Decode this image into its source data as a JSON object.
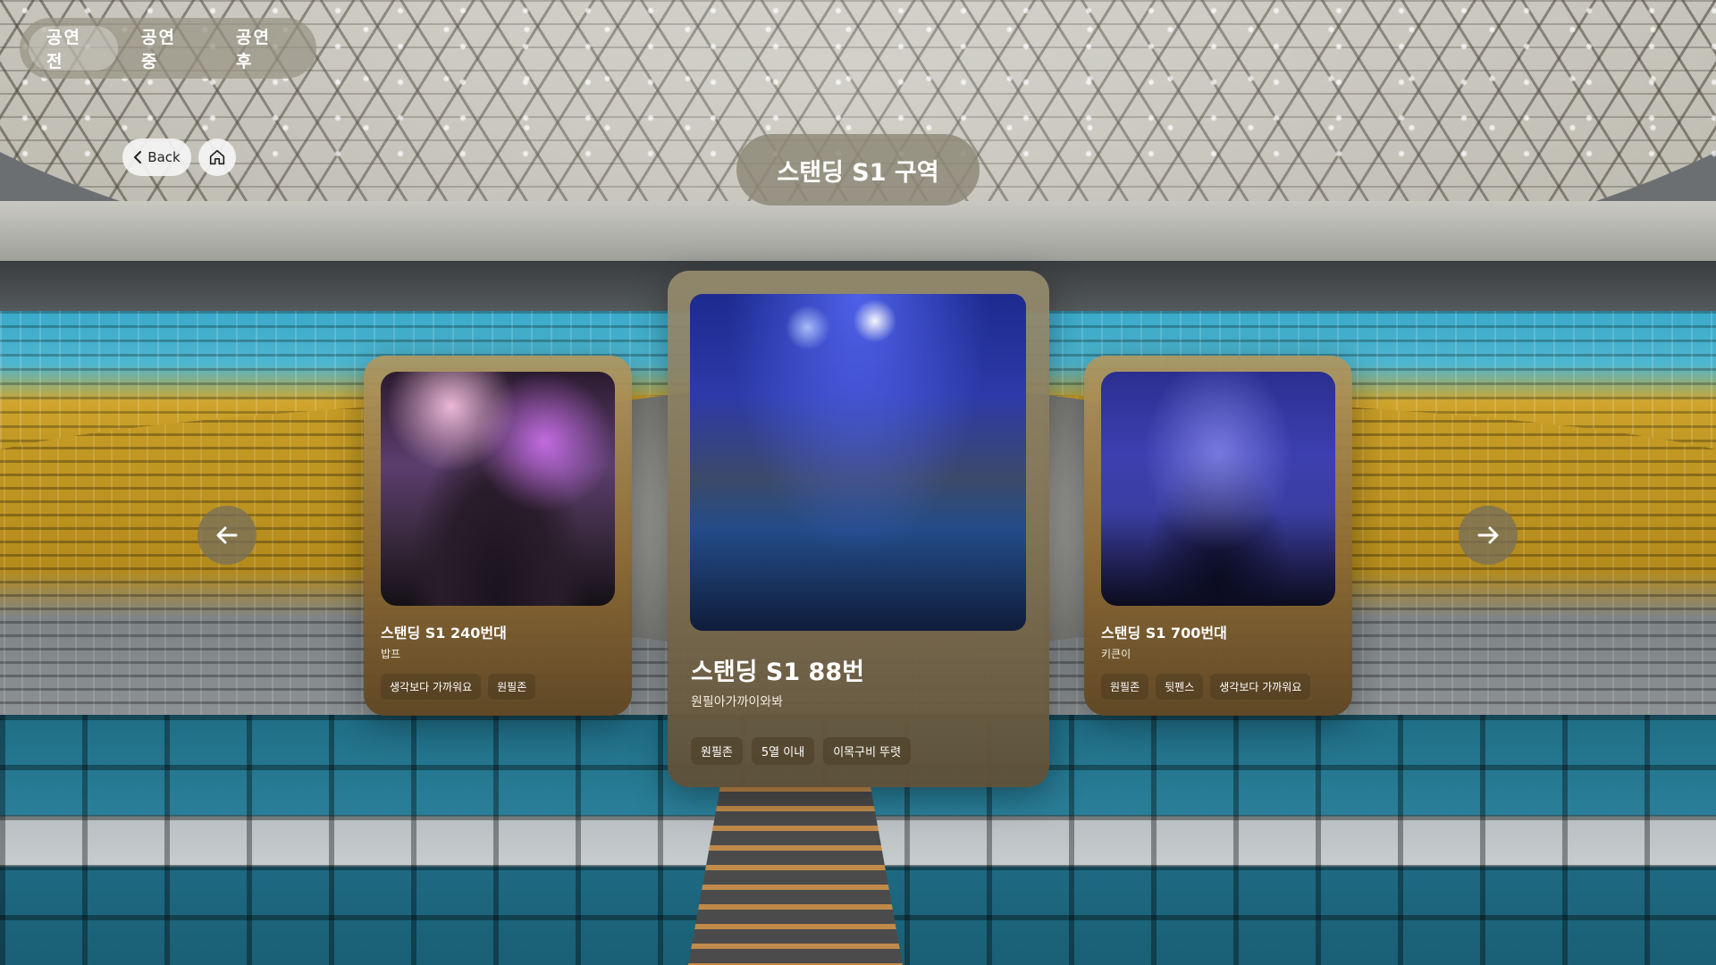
{
  "tabs": [
    {
      "label": "공연 전",
      "active": true
    },
    {
      "label": "공연 중",
      "active": false
    },
    {
      "label": "공연 후",
      "active": false
    }
  ],
  "nav": {
    "back_label": "Back",
    "back_icon": "chevron-left-icon",
    "home_icon": "home-icon"
  },
  "section": {
    "title": "스탠딩 S1 구역"
  },
  "carousel": {
    "prev_icon": "arrow-left-icon",
    "next_icon": "arrow-right-icon",
    "cards": {
      "left": {
        "title": "스탠딩 S1 240번대",
        "author": "밥프",
        "tags": [
          "생각보다 가까워요",
          "원필존"
        ]
      },
      "center": {
        "title": "스탠딩 S1 88번",
        "author": "원필아가까이와봐",
        "tags": [
          "원필존",
          "5열 이내",
          "이목구비 뚜렷"
        ]
      },
      "right": {
        "title": "스탠딩 S1 700번대",
        "author": "키큰이",
        "tags": [
          "원필존",
          "뒷펜스",
          "생각보다 가까워요"
        ]
      }
    }
  }
}
